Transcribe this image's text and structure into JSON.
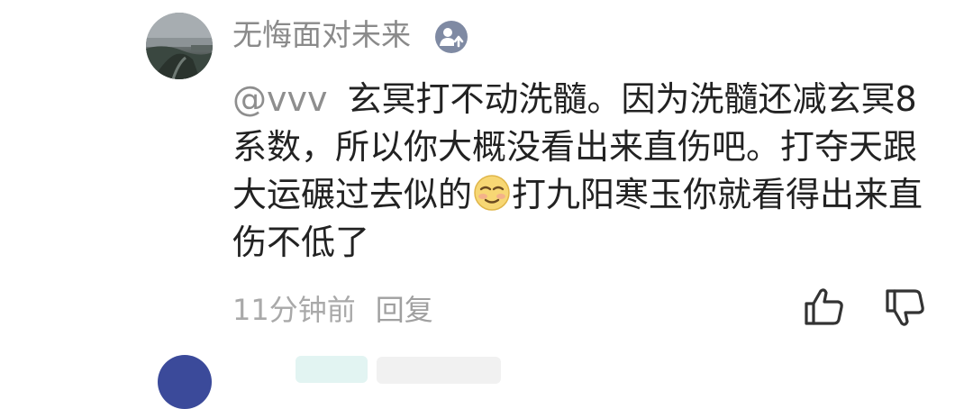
{
  "comment": {
    "username": "无悔面对未来",
    "mention": "@vvv",
    "text_part1": "玄冥打不动洗髓。因为洗髓还减玄冥8系数，所以你大概没看出来直伤吧。打夺天跟大运碾过去似的",
    "emoji": "smug-face-emoji",
    "text_part2": "打九阳寒玉你就看得出来直伤不低了",
    "timestamp": "11分钟前",
    "reply_label": "回复"
  },
  "icons": {
    "avatar": "landscape-photo-avatar",
    "badge": "user-upload-badge-icon",
    "like": "thumbs-up-icon",
    "dislike": "thumbs-down-icon"
  },
  "colors": {
    "username": "#8a8a8a",
    "body": "#222222",
    "meta": "#a9a9a9",
    "badge": "#7f8aa3"
  }
}
